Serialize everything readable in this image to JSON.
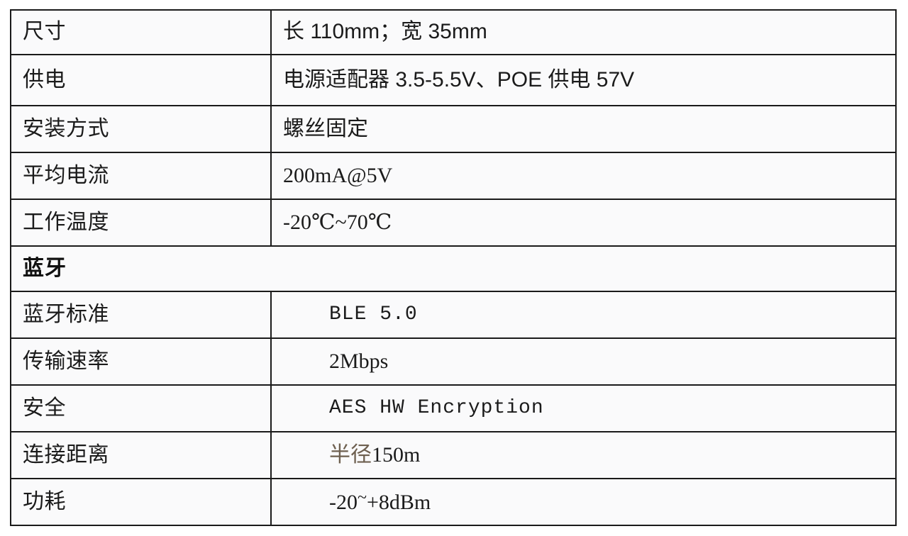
{
  "document": {
    "type": "specification-table",
    "columns": 2,
    "colors": {
      "border": "#1a1a1a",
      "cell_background": "#fafafb",
      "page_background": "#ffffff",
      "text": "#1b1b1b",
      "sepia_text": "#6e6050"
    }
  },
  "table": {
    "rows": [
      {
        "kind": "data",
        "label": "尺寸",
        "value": "长 110mm；宽 35mm"
      },
      {
        "kind": "data",
        "label": "供电",
        "value": "电源适配器 3.5-5.5V、POE 供电 57V"
      },
      {
        "kind": "data",
        "label": "安装方式",
        "value": "螺丝固定"
      },
      {
        "kind": "data",
        "label": "平均电流",
        "value": "200mA@5V"
      },
      {
        "kind": "data",
        "label": "工作温度",
        "value": "-20℃~70℃"
      },
      {
        "kind": "section",
        "label": "蓝牙",
        "value": ""
      },
      {
        "kind": "data",
        "label": "蓝牙标准",
        "value": "BLE 5.0"
      },
      {
        "kind": "data",
        "label": "传输速率",
        "value": "2Mbps"
      },
      {
        "kind": "data",
        "label": "安全",
        "value": "AES HW Encryption"
      },
      {
        "kind": "data",
        "label": "连接距离",
        "value": "半径150m"
      },
      {
        "kind": "data",
        "label": "功耗",
        "value": "-20~+8dBm"
      }
    ]
  },
  "cells": {
    "r0_label": "尺寸",
    "r0_value_a": "长 110mm；宽 35mm",
    "r1_label": "供电",
    "r1_value_a": "电源适配器 3.5-5.5V、POE 供电 57V",
    "r2_label": "安装方式",
    "r2_value_a": "螺丝固定",
    "r3_label": "平均电流",
    "r3_value_a": "200mA@5V",
    "r4_label": "工作温度",
    "r4_value_a": "-20℃~70℃",
    "section_label": "蓝牙",
    "r5_label": "蓝牙标准",
    "r5_value_a": "BLE 5.0",
    "r6_label": "传输速率",
    "r6_value_a": "2Mbps",
    "r7_label": "安全",
    "r7_value_a": "AES HW Encryption",
    "r8_label": "连接距离",
    "r8_value_sepia": "半径",
    "r8_value_rest": "150m",
    "r9_label": "功耗",
    "r9_value_pre": "-20",
    "r9_value_tilde": "~",
    "r9_value_post": "+8dBm"
  }
}
